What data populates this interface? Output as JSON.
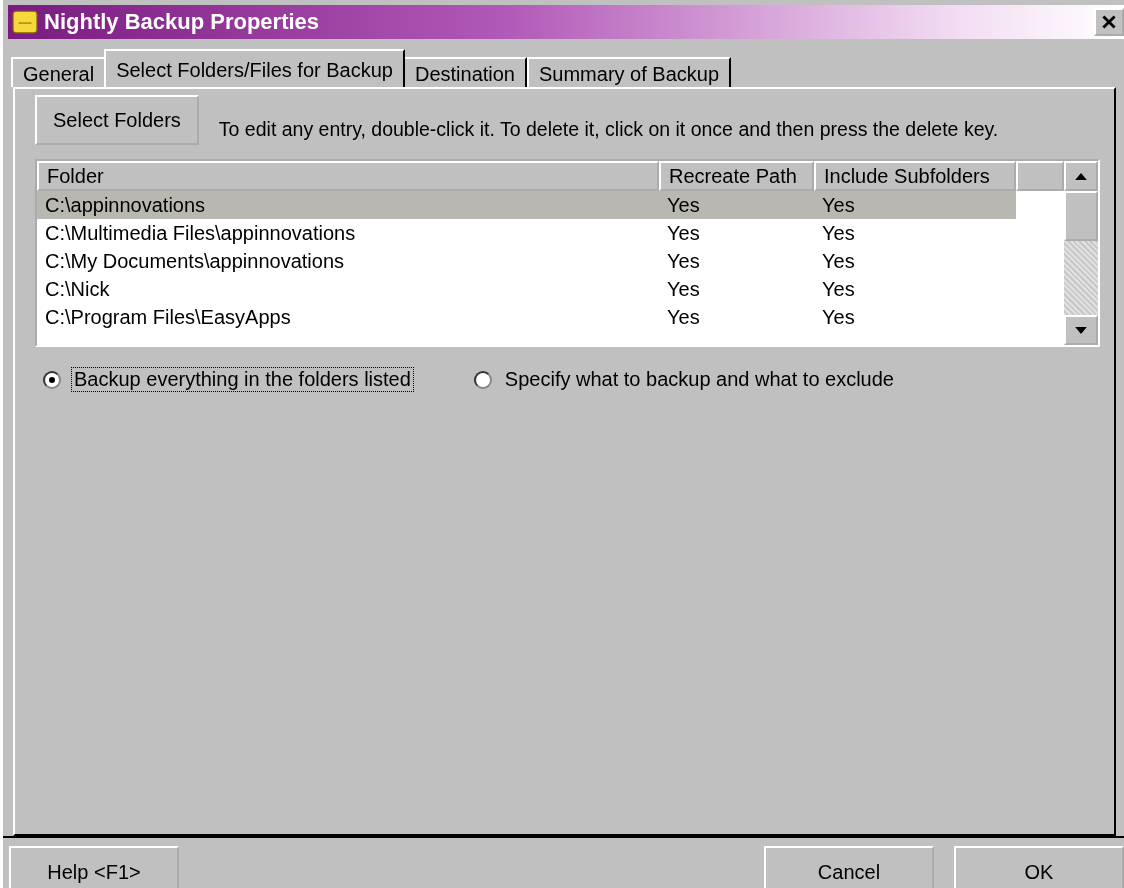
{
  "window": {
    "title": "Nightly Backup Properties"
  },
  "tabs": [
    {
      "label": "General",
      "selected": false
    },
    {
      "label": "Select Folders/Files for Backup",
      "selected": true
    },
    {
      "label": "Destination",
      "selected": false
    },
    {
      "label": "Summary of Backup",
      "selected": false
    }
  ],
  "select_button": "Select Folders",
  "instruction": "To edit any entry, double-click it. To delete it, click on it once and then press the delete key.",
  "table": {
    "columns": [
      "Folder",
      "Recreate Path",
      "Include Subfolders"
    ],
    "rows": [
      {
        "cells": [
          "C:\\appinnovations",
          "Yes",
          "Yes"
        ],
        "selected": true
      },
      {
        "cells": [
          "C:\\Multimedia Files\\appinnovations",
          "Yes",
          "Yes"
        ],
        "selected": false
      },
      {
        "cells": [
          "C:\\My Documents\\appinnovations",
          "Yes",
          "Yes"
        ],
        "selected": false
      },
      {
        "cells": [
          "C:\\Nick",
          "Yes",
          "Yes"
        ],
        "selected": false
      },
      {
        "cells": [
          "C:\\Program Files\\EasyApps",
          "Yes",
          "Yes"
        ],
        "selected": false
      }
    ]
  },
  "options": [
    {
      "label": "Backup everything in the folders listed",
      "selected": true
    },
    {
      "label": "Specify what to backup and what to exclude",
      "selected": false
    }
  ],
  "buttons": {
    "help": "Help <F1>",
    "cancel": "Cancel",
    "ok": "OK"
  }
}
